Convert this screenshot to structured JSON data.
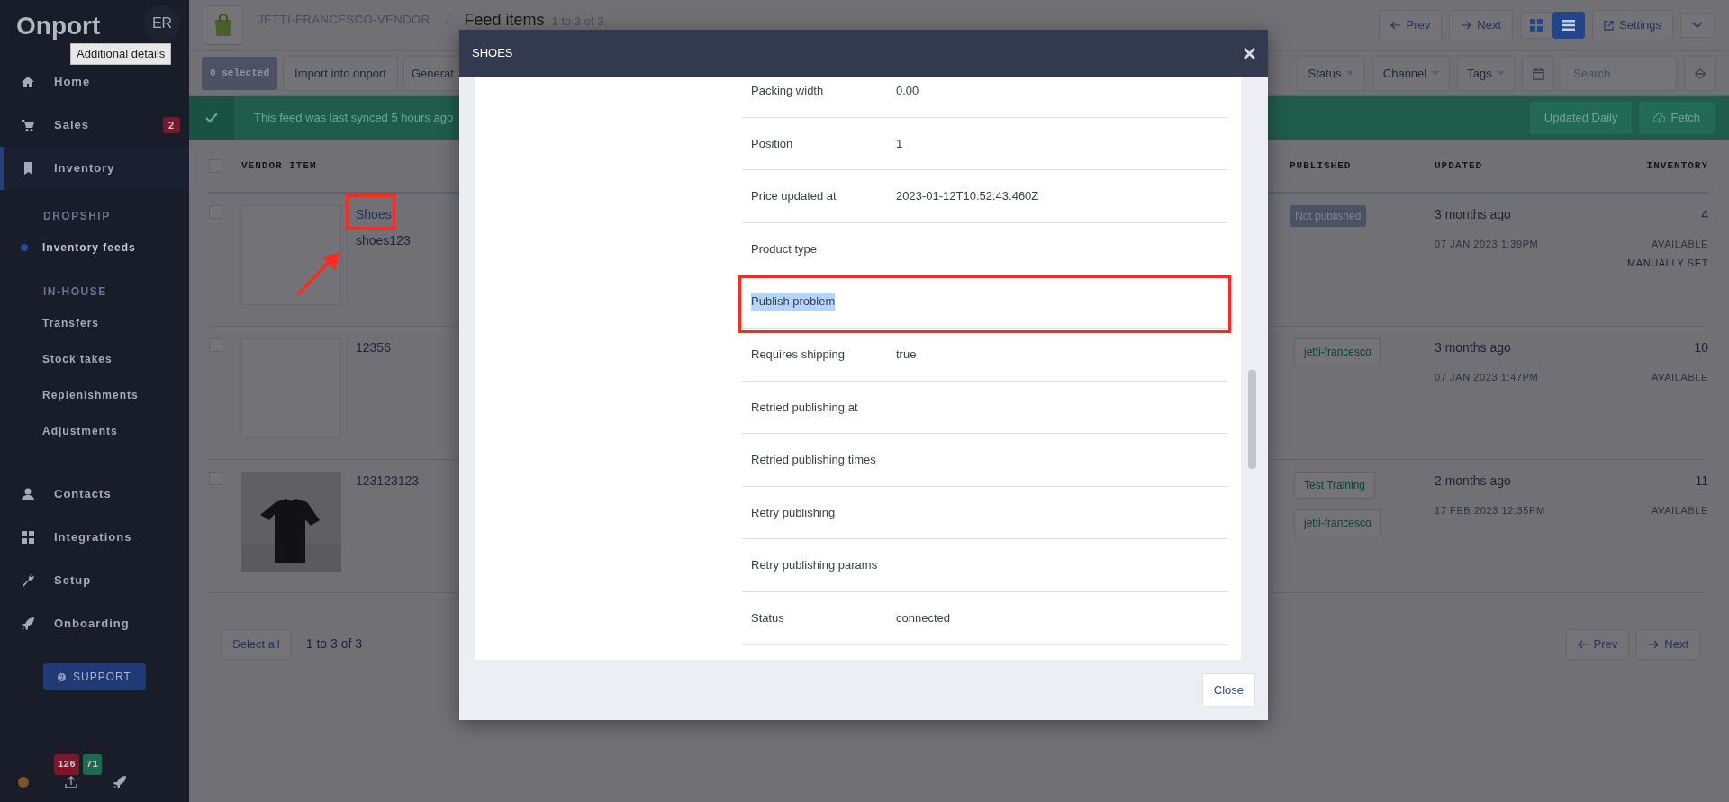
{
  "sidebar": {
    "logo": "Onport",
    "avatar": "ER",
    "tooltip": "Additional details",
    "items": [
      {
        "kind": "item",
        "label": "Home",
        "selected": false
      },
      {
        "kind": "item",
        "label": "Sales",
        "badge": "2",
        "selected": false
      },
      {
        "kind": "item",
        "label": "Inventory",
        "selected": true
      },
      {
        "kind": "section",
        "label": "DROPSHIP"
      },
      {
        "kind": "sub",
        "label": "Inventory feeds",
        "selected": true
      },
      {
        "kind": "section",
        "label": "IN-HOUSE"
      },
      {
        "kind": "sub",
        "label": "Transfers",
        "selected": false
      },
      {
        "kind": "sub",
        "label": "Stock takes",
        "selected": false
      },
      {
        "kind": "sub",
        "label": "Replenishments",
        "selected": false
      },
      {
        "kind": "sub",
        "label": "Adjustments",
        "selected": false
      },
      {
        "kind": "item",
        "label": "Contacts",
        "selected": false
      },
      {
        "kind": "item",
        "label": "Integrations",
        "selected": false
      },
      {
        "kind": "item",
        "label": "Setup",
        "selected": false
      },
      {
        "kind": "item",
        "label": "Onboarding",
        "selected": false
      }
    ],
    "support": "SUPPORT",
    "counters": [
      {
        "text": "126",
        "color": "#7a1728"
      },
      {
        "text": "71",
        "color": "#1d6a51"
      }
    ]
  },
  "header": {
    "breadcrumb": "JETTI-FRANCESCO-VENDOR",
    "title": "Feed items",
    "count": "1 to 3 of 3",
    "prev": "Prev",
    "next": "Next",
    "views": [
      {
        "selected": false
      },
      {
        "selected": true
      }
    ],
    "settings": "Settings"
  },
  "toolbar": {
    "selected_count": "0 selected",
    "actions": [
      "Import into onport",
      "Generat"
    ],
    "filters": [
      "Status",
      "Channel",
      "Tags"
    ],
    "search": {
      "placeholder": "Search"
    }
  },
  "banner": {
    "text": "This feed was last synced 5 hours ago",
    "schedule": "Updated Daily",
    "fetch": "Fetch"
  },
  "table": {
    "all_checked": false,
    "columns": [
      "VENDOR ITEM",
      "PUBLISHED",
      "UPDATED",
      "INVENTORY"
    ],
    "rows": [
      {
        "checked": false,
        "name": "Shoes",
        "link": true,
        "annotated": true,
        "sku": "shoes123",
        "published": [
          {
            "kind": "status",
            "label": "Not published"
          }
        ],
        "updated": "3 months ago",
        "date": "07 JAN 2023 1:39PM",
        "inventory": "4",
        "availability": "AVAILABLE",
        "note": "MANUALLY SET"
      },
      {
        "checked": false,
        "name": "12356",
        "link": false,
        "annotated": false,
        "published": [
          {
            "kind": "channel",
            "label": "jetti-francesco"
          }
        ],
        "updated": "3 months ago",
        "date": "07 JAN 2023 1:47PM",
        "inventory": "10",
        "availability": "AVAILABLE"
      },
      {
        "checked": false,
        "kind": "picture",
        "name": "123123123",
        "link": false,
        "annotated": false,
        "published": [
          {
            "kind": "channel",
            "label": "Test Training"
          },
          {
            "kind": "channel",
            "label": "jetti-francesco"
          }
        ],
        "updated": "2 months ago",
        "date": "17 FEB 2023 12:35PM",
        "inventory": "11",
        "availability": "AVAILABLE"
      }
    ]
  },
  "pagination": {
    "select_all": "Select all",
    "range": "1 to 3 of 3",
    "prev": "Prev",
    "next": "Next"
  },
  "modal": {
    "title": "SHOES",
    "fields": [
      {
        "label": "Packing width",
        "value": "0.00",
        "highlighted": false
      },
      {
        "label": "Position",
        "value": "1",
        "highlighted": false
      },
      {
        "label": "Price updated at",
        "value": "2023-01-12T10:52:43.460Z",
        "highlighted": false
      },
      {
        "label": "Product type",
        "highlighted": false
      },
      {
        "label": "Publish problem",
        "highlighted": true
      },
      {
        "label": "Requires shipping",
        "value": "true",
        "highlighted": false
      },
      {
        "label": "Retried publishing at",
        "highlighted": false
      },
      {
        "label": "Retried publishing times",
        "highlighted": false
      },
      {
        "label": "Retry publishing",
        "highlighted": false
      },
      {
        "label": "Retry publishing params",
        "highlighted": false
      },
      {
        "label": "Status",
        "value": "connected",
        "highlighted": false
      }
    ],
    "close": "Close"
  }
}
